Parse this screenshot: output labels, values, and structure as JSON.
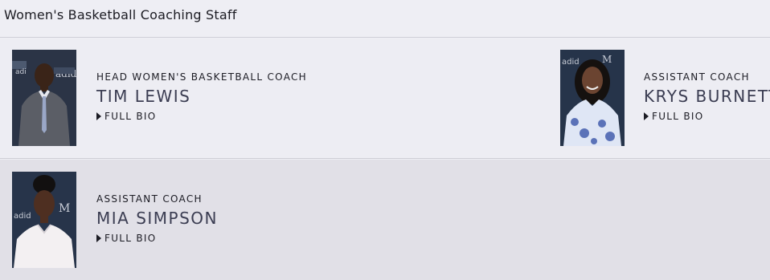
{
  "page": {
    "title": "Women's Basketball Coaching Staff"
  },
  "coaches": [
    {
      "role": "Head Women's Basketball Coach",
      "name": "Tim Lewis",
      "bio_label": "Full Bio"
    },
    {
      "role": "Assistant Coach",
      "name": "Krys Burnett",
      "bio_label": "Full Bio"
    },
    {
      "role": "Assistant Coach",
      "name": "Mia Simpson",
      "bio_label": "Full Bio"
    }
  ],
  "icons": {
    "bio_toggle": "caret-right-icon"
  },
  "colors": {
    "background": "#eeeef4",
    "row_alt": "#e1e0e7",
    "name_text": "#3b3d52"
  }
}
